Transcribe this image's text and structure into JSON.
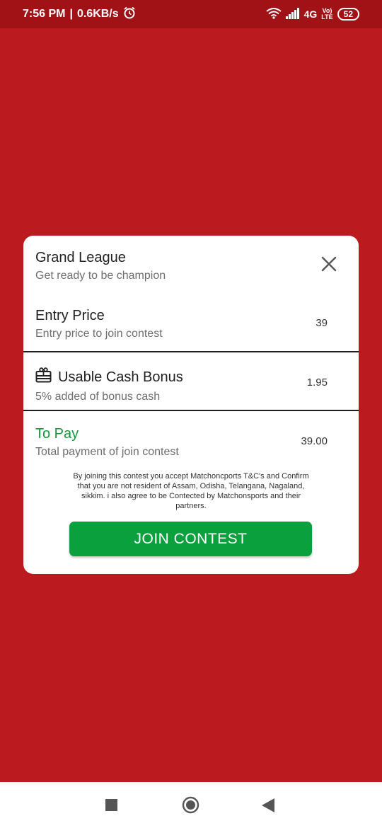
{
  "status_bar": {
    "time": "7:56 PM",
    "separator": "|",
    "speed": "0.6KB/s",
    "network": "4G",
    "volte_top": "Vo)",
    "volte_bottom": "LTE",
    "battery": "52"
  },
  "dialog": {
    "contest": {
      "title": "Grand League",
      "subtitle": "Get ready to be champion"
    },
    "entry": {
      "title": "Entry Price",
      "subtitle": "Entry price to join contest",
      "value": "39"
    },
    "bonus": {
      "title": "Usable Cash Bonus",
      "subtitle": "5% added of bonus cash",
      "value": "1.95"
    },
    "to_pay": {
      "title": "To Pay",
      "subtitle": "Total payment of join contest",
      "value": "39.00"
    },
    "terms": "By joining this contest you accept Matchoncports T&C's and Confirm that you are not resident of Assam, Odisha, Telangana, Nagaland, sikkim. i also agree to be Contected by Matchonsports and their partners.",
    "join_label": "JOIN CONTEST"
  },
  "colors": {
    "background": "#bb1b1e",
    "status_bar": "#a11216",
    "accent_green": "#0aa03e",
    "to_pay_green": "#15963a"
  },
  "icons": {
    "close": "close-icon",
    "gift": "gift-icon",
    "nav_recent": "square-icon",
    "nav_home": "circle-icon",
    "nav_back": "triangle-back-icon"
  }
}
